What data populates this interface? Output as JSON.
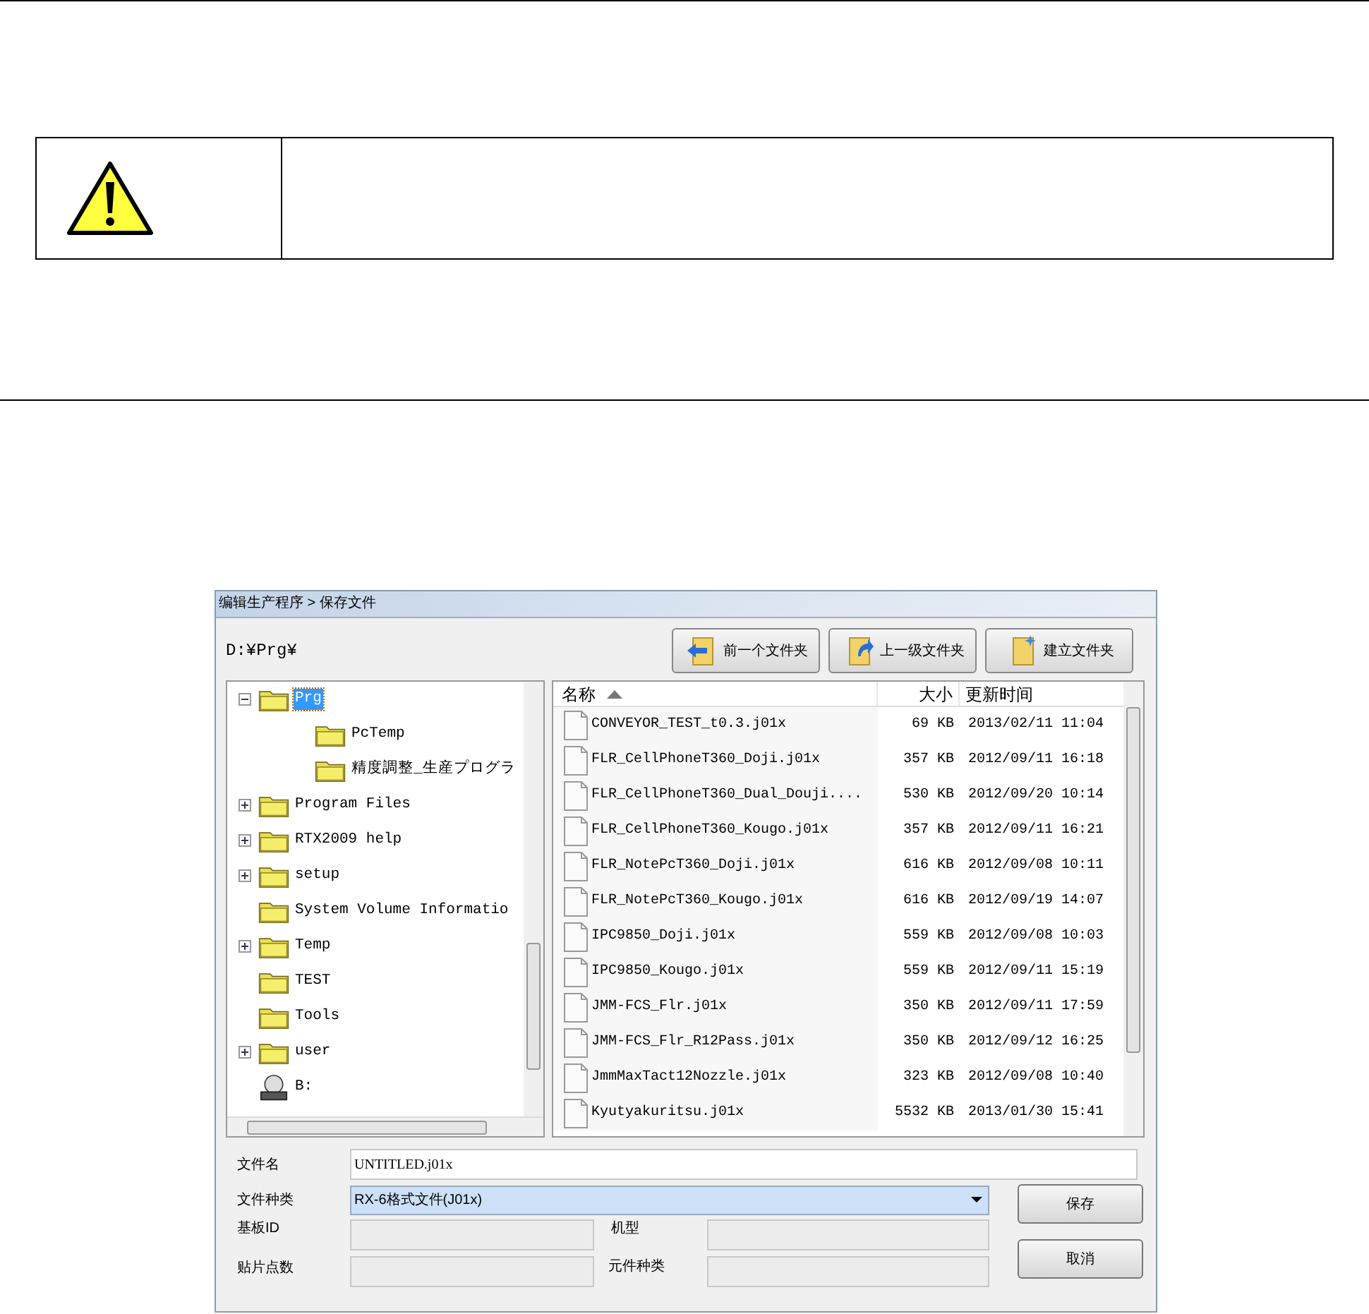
{
  "dialog": {
    "title": "编辑生产程序 > 保存文件",
    "path": "D:¥Prg¥",
    "toolbar": [
      {
        "label": "前一个文件夹",
        "kind": "back"
      },
      {
        "label": "上一级文件夹",
        "kind": "up"
      },
      {
        "label": "建立文件夹",
        "kind": "new"
      }
    ],
    "tree": [
      {
        "label": "Prg",
        "kind": "folder",
        "expanded": true,
        "selected": true,
        "children": [
          {
            "label": "PcTemp",
            "kind": "folder",
            "selected": false
          },
          {
            "label": "精度調整_生産プログラ",
            "kind": "folder",
            "selected": false
          }
        ]
      },
      {
        "label": "Program Files",
        "kind": "folder",
        "expanded": false,
        "selected": false
      },
      {
        "label": "RTX2009 help",
        "kind": "folder",
        "expanded": false,
        "selected": false
      },
      {
        "label": "setup",
        "kind": "folder",
        "expanded": false,
        "selected": false
      },
      {
        "label": "System Volume Informatio",
        "kind": "folder",
        "selected": false
      },
      {
        "label": "Temp",
        "kind": "folder",
        "expanded": false,
        "selected": false
      },
      {
        "label": "TEST",
        "kind": "folder",
        "selected": false
      },
      {
        "label": "Tools",
        "kind": "folder",
        "selected": false
      },
      {
        "label": "user",
        "kind": "folder",
        "expanded": false,
        "selected": false
      },
      {
        "label": "B:",
        "kind": "drive",
        "selected": false
      }
    ],
    "file_list": {
      "columns": [
        "名称",
        "大小",
        "更新时间"
      ],
      "rows": [
        {
          "name": "CONVEYOR_TEST_t0.3.j01x",
          "size": "69 KB",
          "modified": "2013/02/11 11:04"
        },
        {
          "name": "FLR_CellPhoneT360_Doji.j01x",
          "size": "357 KB",
          "modified": "2012/09/11 16:18"
        },
        {
          "name": "FLR_CellPhoneT360_Dual_Douji....",
          "size": "530 KB",
          "modified": "2012/09/20 10:14"
        },
        {
          "name": "FLR_CellPhoneT360_Kougo.j01x",
          "size": "357 KB",
          "modified": "2012/09/11 16:21"
        },
        {
          "name": "FLR_NotePcT360_Doji.j01x",
          "size": "616 KB",
          "modified": "2012/09/08 10:11"
        },
        {
          "name": "FLR_NotePcT360_Kougo.j01x",
          "size": "616 KB",
          "modified": "2012/09/19 14:07"
        },
        {
          "name": "IPC9850_Doji.j01x",
          "size": "559 KB",
          "modified": "2012/09/08 10:03"
        },
        {
          "name": "IPC9850_Kougo.j01x",
          "size": "559 KB",
          "modified": "2012/09/11 15:19"
        },
        {
          "name": "JMM-FCS_Flr.j01x",
          "size": "350 KB",
          "modified": "2012/09/11 17:59"
        },
        {
          "name": "JMM-FCS_Flr_R12Pass.j01x",
          "size": "350 KB",
          "modified": "2012/09/12 16:25"
        },
        {
          "name": "JmmMaxTact12Nozzle.j01x",
          "size": "323 KB",
          "modified": "2012/09/08 10:40"
        },
        {
          "name": "Kyutyakuritsu.j01x",
          "size": "5532 KB",
          "modified": "2013/01/30 15:41"
        }
      ]
    },
    "file_name": {
      "label": "文件名",
      "value": "UNTITLED.j01x"
    },
    "file_type": {
      "label": "文件种类",
      "value": "RX-6格式文件(J01x)"
    },
    "board_id": {
      "label": "基板ID"
    },
    "model": {
      "label": "机型"
    },
    "placement_points": {
      "label": "贴片点数"
    },
    "component_type": {
      "label": "元件种类"
    },
    "buttons": [
      "保存",
      "取消"
    ]
  }
}
